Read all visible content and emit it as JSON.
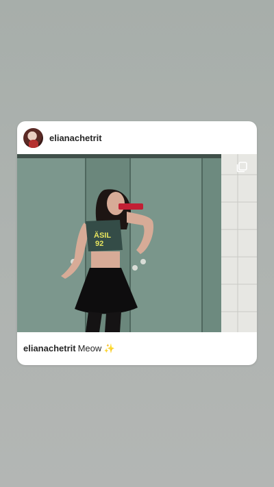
{
  "post": {
    "username": "elianachetrit",
    "caption_user": "elianachetrit",
    "caption_text": "Meow ✨"
  },
  "icons": {
    "multiple_photos": "multiple-photos-icon"
  },
  "colors": {
    "background": "#aeb3b0",
    "card": "#ffffff",
    "text": "#262626"
  }
}
